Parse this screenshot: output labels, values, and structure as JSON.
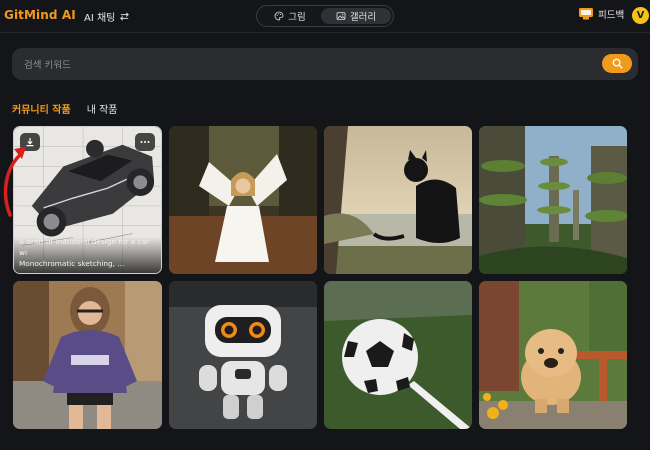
{
  "brand": {
    "name": "GitMind AI"
  },
  "header": {
    "chat_label": "AI 채팅",
    "segments": [
      {
        "label": "그림"
      },
      {
        "label": "갤러리"
      }
    ],
    "feedback_label": "피드백",
    "avatar_initial": "V"
  },
  "search": {
    "placeholder": "검색 키워드",
    "value": ""
  },
  "tabs": [
    {
      "label": "커뮤니티 작품",
      "active": true
    },
    {
      "label": "내 작품",
      "active": false
    }
  ],
  "gallery": {
    "items": [
      {
        "subject": "industrial car sketch",
        "prompt": "A draft of industrial design for a car wi\nMonochromatic sketching, ..."
      },
      {
        "subject": "angel girl in forest"
      },
      {
        "subject": "black cat at lake"
      },
      {
        "subject": "tree houses city"
      },
      {
        "subject": "woman in purple hoodie"
      },
      {
        "subject": "white robot"
      },
      {
        "subject": "soccer ball on grass"
      },
      {
        "subject": "chow chow dog with flowers"
      }
    ]
  },
  "colors": {
    "accent": "#f29a1c",
    "background": "#141518",
    "search_bg": "#2a2c30",
    "annotation": "#d8201c"
  }
}
